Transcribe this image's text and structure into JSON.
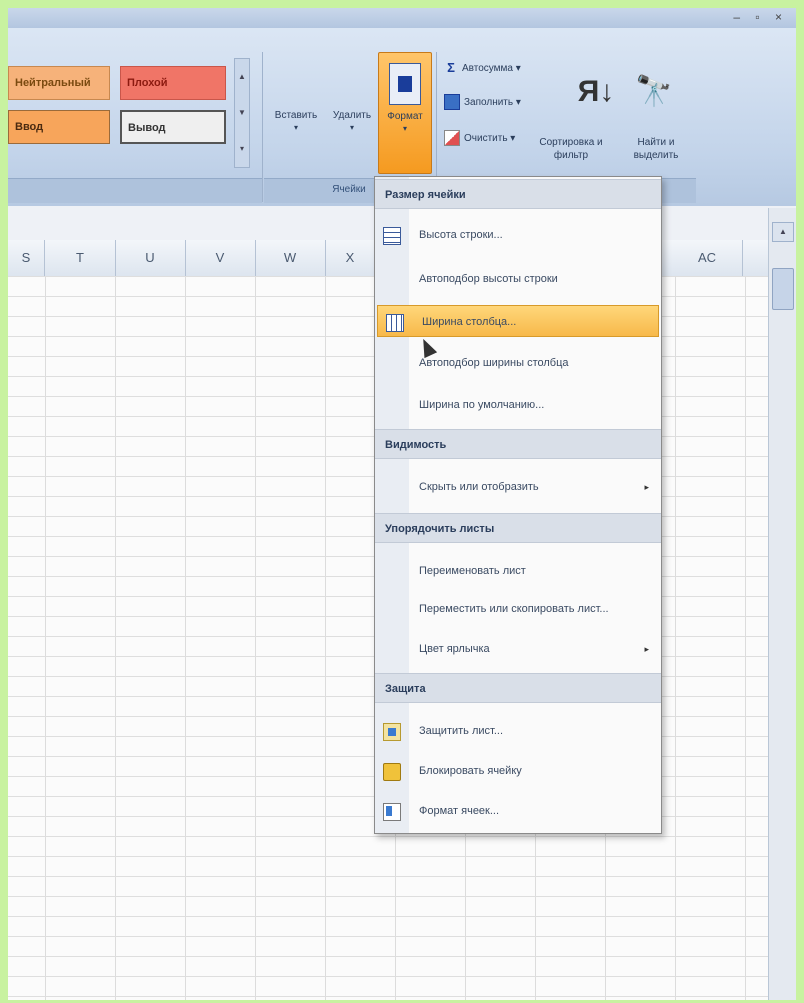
{
  "window": {
    "controls": "– ▫ ×"
  },
  "ribbon": {
    "cell_styles": {
      "neutral": "Нейтральный",
      "bad": "Плохой",
      "input": "Ввод",
      "output": "Вывод"
    },
    "cells_group": {
      "insert": "Вставить",
      "delete": "Удалить",
      "format": "Формат",
      "label": "Ячейки"
    },
    "editing_group": {
      "autosum": "Автосумма",
      "fill": "Заполнить",
      "clear": "Очистить",
      "sort_filter": "Сортировка и фильтр",
      "find_select": "Найти и выделить"
    },
    "sort_icon": "Я↓",
    "find_icon": "🔭"
  },
  "columns": [
    "S",
    "T",
    "U",
    "V",
    "W",
    "X",
    "AC"
  ],
  "format_menu": {
    "sections": [
      {
        "header": "Размер ячейки",
        "items": [
          {
            "label": "Высота строки...",
            "icon": "row-height-icon"
          },
          {
            "label": "Автоподбор высоты строки",
            "icon": ""
          },
          {
            "label": "Ширина столбца...",
            "icon": "column-width-icon",
            "highlighted": true
          },
          {
            "label": "Автоподбор ширины столбца",
            "icon": ""
          },
          {
            "label": "Ширина по умолчанию...",
            "icon": ""
          }
        ]
      },
      {
        "header": "Видимость",
        "items": [
          {
            "label": "Скрыть или отобразить",
            "submenu": true
          }
        ]
      },
      {
        "header": "Упорядочить листы",
        "items": [
          {
            "label": "Переименовать лист"
          },
          {
            "label": "Переместить или скопировать лист..."
          },
          {
            "label": "Цвет ярлычка",
            "submenu": true
          }
        ]
      },
      {
        "header": "Защита",
        "items": [
          {
            "label": "Защитить лист...",
            "icon": "protect-sheet-icon"
          },
          {
            "label": "Блокировать ячейку",
            "icon": "lock-icon"
          },
          {
            "label": "Формат ячеек...",
            "icon": "format-cells-icon"
          }
        ]
      }
    ],
    "submenu_arrow": "▸"
  },
  "colors": {
    "menu_highlight": "#f7b94a",
    "format_button": "#f59a20",
    "frame": "#c8f2a0"
  }
}
